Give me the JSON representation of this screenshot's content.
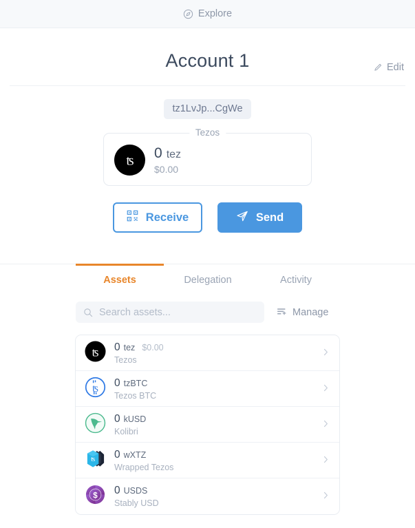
{
  "topbar": {
    "explore_label": "Explore",
    "explore_icon": "compass-icon"
  },
  "account": {
    "edit_label": "Edit",
    "edit_icon": "pencil-icon",
    "title": "Account 1",
    "address": "tz1LvJp...CgWe"
  },
  "balance_card": {
    "legend": "Tezos",
    "amount": "0",
    "symbol": "tez",
    "fiat": "$0.00",
    "logo_icon": "tezos-logo-icon"
  },
  "actions": {
    "receive_label": "Receive",
    "receive_icon": "qr-code-icon",
    "send_label": "Send",
    "send_icon": "paper-plane-icon"
  },
  "tabs": [
    {
      "label": "Assets",
      "active": true
    },
    {
      "label": "Delegation",
      "active": false
    },
    {
      "label": "Activity",
      "active": false
    }
  ],
  "tools": {
    "search_placeholder": "Search assets...",
    "search_value": "",
    "search_icon": "search-icon",
    "manage_label": "Manage",
    "manage_icon": "manage-list-icon"
  },
  "assets": [
    {
      "amount": "0",
      "symbol": "tez",
      "fiat": "$0.00",
      "name": "Tezos",
      "icon": "tezos-logo-icon",
      "chevron": "chevron-right-icon"
    },
    {
      "amount": "0",
      "symbol": "tzBTC",
      "fiat": "",
      "name": "Tezos BTC",
      "icon": "tzbtc-icon",
      "chevron": "chevron-right-icon"
    },
    {
      "amount": "0",
      "symbol": "kUSD",
      "fiat": "",
      "name": "Kolibri",
      "icon": "kolibri-icon",
      "chevron": "chevron-right-icon"
    },
    {
      "amount": "0",
      "symbol": "wXTZ",
      "fiat": "",
      "name": "Wrapped Tezos",
      "icon": "wxtz-icon",
      "chevron": "chevron-right-icon"
    },
    {
      "amount": "0",
      "symbol": "USDS",
      "fiat": "",
      "name": "Stably USD",
      "icon": "usds-icon",
      "chevron": "chevron-right-icon"
    }
  ],
  "colors": {
    "accent_blue": "#4a97e0",
    "accent_orange": "#e8862b",
    "text_dark": "#3c4a5e",
    "text_muted": "#9aa4b4",
    "tzbtc_blue": "#2f7ae5",
    "kolibri_green": "#4cba8e",
    "wxtz_cyan": "#2bb6e8",
    "usds_purple": "#8b43a8"
  }
}
